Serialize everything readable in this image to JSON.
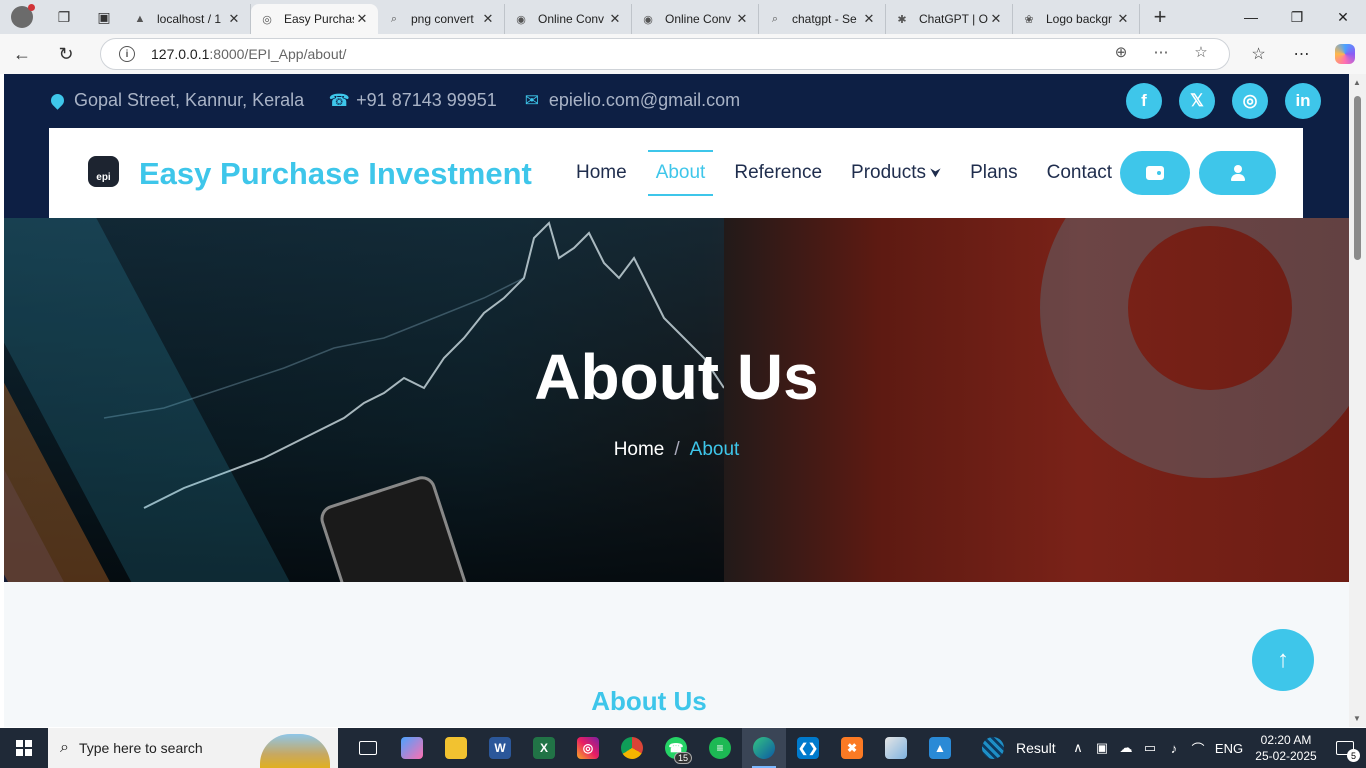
{
  "browser": {
    "tabs": [
      {
        "label": "localhost / 1",
        "favicon": "phpmyadmin-icon"
      },
      {
        "label": "Easy Purchas",
        "favicon": "globe-icon",
        "active": true
      },
      {
        "label": "png convert",
        "favicon": "search-icon"
      },
      {
        "label": "Online Conv",
        "favicon": "converter-icon"
      },
      {
        "label": "Online Conv",
        "favicon": "converter-icon"
      },
      {
        "label": "chatgpt - Se",
        "favicon": "search-icon"
      },
      {
        "label": "ChatGPT | O",
        "favicon": "chatgpt-icon"
      },
      {
        "label": "Logo backgr",
        "favicon": "openai-icon"
      }
    ],
    "url_host": "127.0.0.1",
    "url_path": ":8000/EPI_App/about/"
  },
  "site": {
    "address": "Gopal Street, Kannur, Kerala",
    "phone": "+91 87143 99951",
    "email": "epielio.com@gmail.com",
    "socials": [
      "facebook",
      "twitter",
      "instagram",
      "linkedin"
    ],
    "logo_text": "epi",
    "brand": "Easy Purchase Investment",
    "menu": {
      "home": "Home",
      "about": "About",
      "reference": "Reference",
      "products": "Products",
      "plans": "Plans",
      "contact": "Contact"
    },
    "accent": "#3ec6ea",
    "navy": "#0d1f44"
  },
  "hero": {
    "title": "About Us",
    "crumb_home": "Home",
    "crumb_sep": "/",
    "crumb_current": "About"
  },
  "section": {
    "title": "About Us"
  },
  "taskbar": {
    "search_placeholder": "Type here to search",
    "whatsapp_badge": "15",
    "result_label": "Result",
    "lang": "ENG",
    "time": "02:20 AM",
    "date": "25-02-2025",
    "notifications": "5"
  }
}
